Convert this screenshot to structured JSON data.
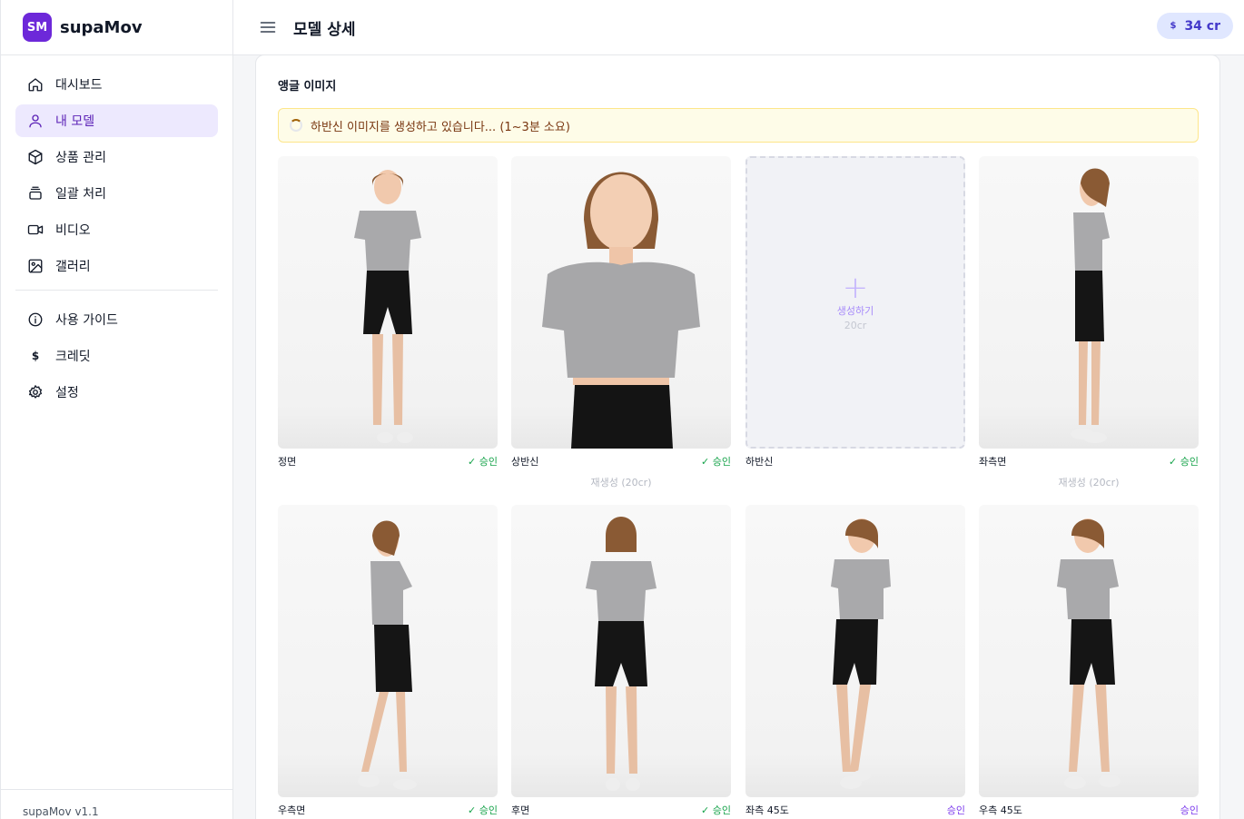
{
  "brand": {
    "logo": "SM",
    "name": "supaMov"
  },
  "sidebar": {
    "items": [
      {
        "label": "대시보드",
        "icon": "home-icon",
        "active": false
      },
      {
        "label": "내 모델",
        "icon": "user-icon",
        "active": true
      },
      {
        "label": "상품 관리",
        "icon": "box-icon",
        "active": false
      },
      {
        "label": "일괄 처리",
        "icon": "layers-icon",
        "active": false
      },
      {
        "label": "비디오",
        "icon": "video-icon",
        "active": false
      },
      {
        "label": "갤러리",
        "icon": "image-icon",
        "active": false
      }
    ],
    "secondary": [
      {
        "label": "사용 가이드",
        "icon": "info-icon"
      },
      {
        "label": "크레딧",
        "icon": "dollar-icon"
      },
      {
        "label": "설정",
        "icon": "gear-icon"
      }
    ],
    "version": "supaMov v1.1"
  },
  "header": {
    "title": "모델 상세",
    "credits": "34 cr",
    "credits_symbol": "$"
  },
  "section": {
    "title": "앵글 이미지",
    "notice": "하반신 이미지를 생성하고 있습니다... (1~3분 소요)"
  },
  "tiles": [
    {
      "label": "정면",
      "status": "✓ 승인",
      "regen": ""
    },
    {
      "label": "상반신",
      "status": "✓ 승인",
      "regen": "재생성 (20cr)"
    },
    {
      "label": "하반신",
      "status": "",
      "regen": "",
      "empty_label": "생성하기",
      "empty_cost": "20cr"
    },
    {
      "label": "좌측면",
      "status": "✓ 승인",
      "regen": "재생성 (20cr)"
    },
    {
      "label": "우측면",
      "status": "✓ 승인",
      "regen": ""
    },
    {
      "label": "후면",
      "status": "✓ 승인",
      "regen": ""
    },
    {
      "label": "좌측 45도",
      "status": "승인",
      "regen": ""
    },
    {
      "label": "우측 45도",
      "status": "승인",
      "regen": ""
    }
  ],
  "colors": {
    "accent": "#6d28d9",
    "approved": "#16a34a",
    "pending": "#7c3aed"
  }
}
